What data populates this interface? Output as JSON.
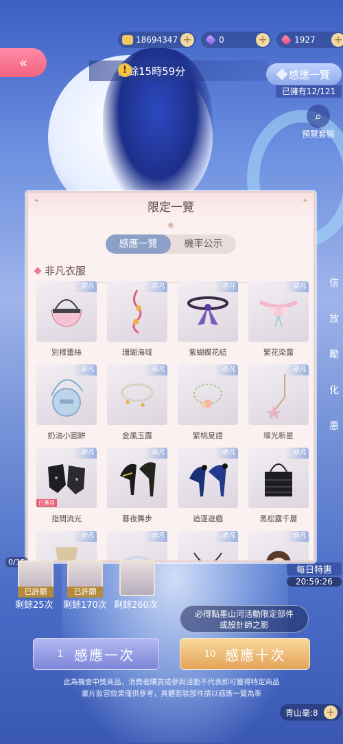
{
  "currency": {
    "coins": "18694347",
    "diamonds": "0",
    "gems": "1927"
  },
  "header": {
    "back_icon": "double-chevron-left-icon",
    "timer": "剩餘15時59分",
    "induction_list": "感應一覽",
    "owned": "已擁有12/121",
    "preview": "預覽套裝"
  },
  "side": {
    "items": [
      "信",
      "放",
      "勵",
      "化",
      "惠"
    ]
  },
  "modal": {
    "title": "限定一覽",
    "tabs": [
      "感應一覽",
      "機率公示"
    ],
    "active_tab": 0,
    "section_title": "非凡衣服",
    "badge": "非凡",
    "obtained": "已獲得",
    "items": [
      {
        "label": "別樣蕾絲",
        "icon": "handbag-icon"
      },
      {
        "label": "珊瑚海域",
        "icon": "coral-earring-icon"
      },
      {
        "label": "紫蝴蝶花結",
        "icon": "choker-icon"
      },
      {
        "label": "繁花染露",
        "icon": "flower-choker-icon"
      },
      {
        "label": "奶油小圓餅",
        "icon": "round-bag-icon"
      },
      {
        "label": "金風玉露",
        "icon": "bracelet-icon"
      },
      {
        "label": "繁桃夏語",
        "icon": "bracelet-beads-icon"
      },
      {
        "label": "璨光新星",
        "icon": "star-earring-icon"
      },
      {
        "label": "指間流光",
        "icon": "gloves-icon",
        "obtained": true
      },
      {
        "label": "暮夜舞步",
        "icon": "heels-icon"
      },
      {
        "label": "追逐遊戲",
        "icon": "blue-heels-icon"
      },
      {
        "label": "黑松露千層",
        "icon": "black-bag-icon"
      },
      {
        "label": "",
        "icon": "chain-icon"
      },
      {
        "label": "",
        "icon": "tiara-icon"
      },
      {
        "label": "",
        "icon": "necklace-icon"
      },
      {
        "label": "",
        "icon": "hairstyle-icon"
      }
    ]
  },
  "portraits": {
    "progress": "0/15",
    "items": [
      {
        "label": "已許願",
        "count": "剩餘25次"
      },
      {
        "label": "已許願",
        "count": "剩餘170次"
      },
      {
        "label": "",
        "count": "剩餘260次"
      }
    ]
  },
  "daily_deal": {
    "title": "每日特惠",
    "time": "20:59:26"
  },
  "guarantee": {
    "line1": "必得點墨山河活動限定部件",
    "line2": "或設計師之影"
  },
  "buttons": {
    "one_num": "1",
    "one_label": "感應一次",
    "ten_num": "10",
    "ten_label": "感應十次"
  },
  "disclaimer": {
    "line1": "此為機會中獎商品，消費者購買或參與活動不代表即可獲得特定商品",
    "line2": "畫片妝容效果僅供參考，具體套裝部件請以感應一覽為準"
  },
  "bottom_item": {
    "label": "青山毫:8"
  }
}
